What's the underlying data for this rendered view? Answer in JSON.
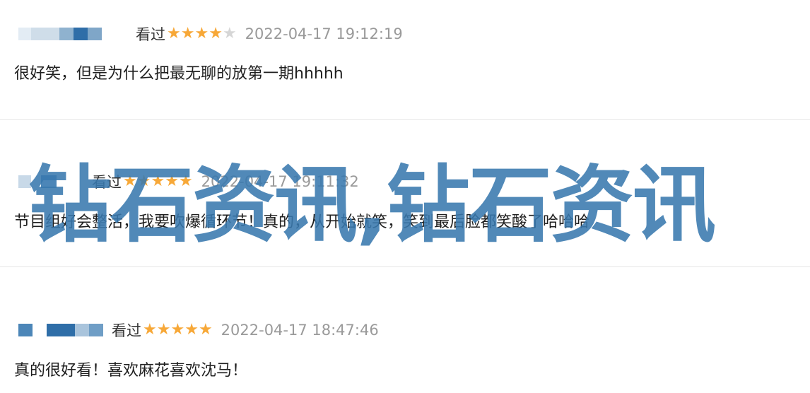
{
  "reviews": [
    {
      "status": "看过",
      "rating": 4,
      "time": "2022-04-17 19:12:19",
      "content": "很好笑，但是为什么把最无聊的放第一期hhhhh",
      "avatar": [
        "#e3ecf4",
        "#cfdde9",
        "#8fb2cf",
        "#2f6ea8",
        "#7fa6c8"
      ]
    },
    {
      "status": "看过",
      "rating": 5,
      "time": "2022-04-17 19:11:32",
      "content": "节目组好会整活，我要吹爆循环节！真的，从开始就笑，笑到最后脸都笑酸了哈哈哈",
      "avatar": [
        "#c8d9e8",
        "#ffffff",
        "#4c86b8",
        "#ffffff",
        "#dbe6ef"
      ]
    },
    {
      "status": "看过",
      "rating": 5,
      "time": "2022-04-17 18:47:46",
      "content": "真的很好看！喜欢麻花喜欢沈马！",
      "avatar": [
        "#4c86b8",
        "#ffffff",
        "#2f6ea8",
        "#a9c4dc",
        "#6f9ec6"
      ]
    }
  ],
  "watermark": "钻石资讯,钻石资讯",
  "colors": {
    "accent": "#3979ae",
    "star": "#f7a838",
    "meta": "#9a9a9a"
  }
}
